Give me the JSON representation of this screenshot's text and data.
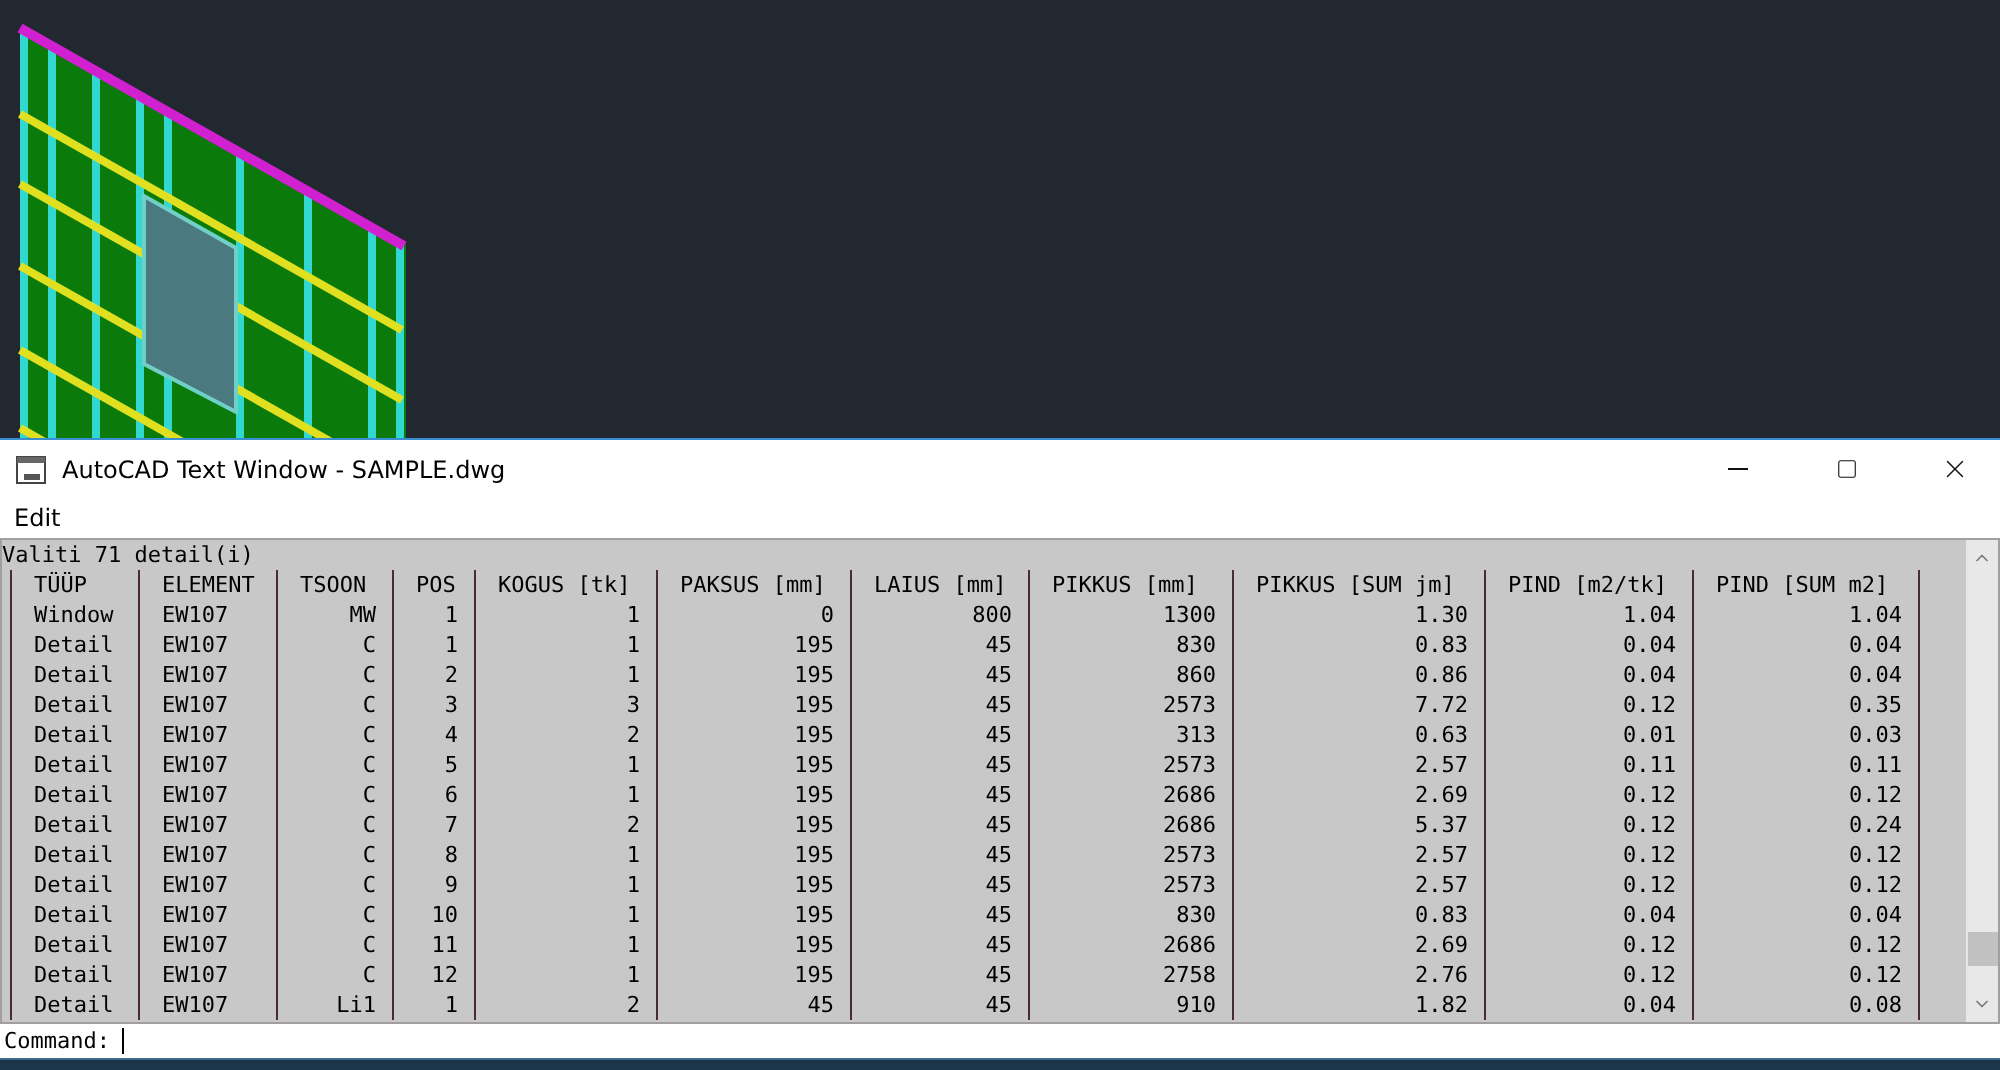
{
  "window": {
    "title": "AutoCAD Text Window - SAMPLE.dwg"
  },
  "menu": [
    "Edit"
  ],
  "output": {
    "message": "Valiti 71 detail(i)",
    "columns": [
      {
        "label": "TÜÜP",
        "kind": "text"
      },
      {
        "label": "ELEMENT",
        "kind": "text"
      },
      {
        "label": "TSOON",
        "kind": "number"
      },
      {
        "label": "POS",
        "kind": "number"
      },
      {
        "label": "KOGUS [tk]",
        "kind": "number"
      },
      {
        "label": "PAKSUS [mm]",
        "kind": "number"
      },
      {
        "label": "LAIUS [mm]",
        "kind": "number"
      },
      {
        "label": "PIKKUS [mm]",
        "kind": "number"
      },
      {
        "label": "PIKKUS [SUM jm]",
        "kind": "number"
      },
      {
        "label": "PIND [m2/tk]",
        "kind": "number"
      },
      {
        "label": "PIND [SUM m2]",
        "kind": "number"
      }
    ],
    "rows": [
      [
        "Window",
        "EW107",
        "MW",
        "1",
        "1",
        "0",
        "800",
        "1300",
        "1.30",
        "1.04",
        "1.04"
      ],
      [
        "Detail",
        "EW107",
        "C",
        "1",
        "1",
        "195",
        "45",
        "830",
        "0.83",
        "0.04",
        "0.04"
      ],
      [
        "Detail",
        "EW107",
        "C",
        "2",
        "1",
        "195",
        "45",
        "860",
        "0.86",
        "0.04",
        "0.04"
      ],
      [
        "Detail",
        "EW107",
        "C",
        "3",
        "3",
        "195",
        "45",
        "2573",
        "7.72",
        "0.12",
        "0.35"
      ],
      [
        "Detail",
        "EW107",
        "C",
        "4",
        "2",
        "195",
        "45",
        "313",
        "0.63",
        "0.01",
        "0.03"
      ],
      [
        "Detail",
        "EW107",
        "C",
        "5",
        "1",
        "195",
        "45",
        "2573",
        "2.57",
        "0.11",
        "0.11"
      ],
      [
        "Detail",
        "EW107",
        "C",
        "6",
        "1",
        "195",
        "45",
        "2686",
        "2.69",
        "0.12",
        "0.12"
      ],
      [
        "Detail",
        "EW107",
        "C",
        "7",
        "2",
        "195",
        "45",
        "2686",
        "5.37",
        "0.12",
        "0.24"
      ],
      [
        "Detail",
        "EW107",
        "C",
        "8",
        "1",
        "195",
        "45",
        "2573",
        "2.57",
        "0.12",
        "0.12"
      ],
      [
        "Detail",
        "EW107",
        "C",
        "9",
        "1",
        "195",
        "45",
        "2573",
        "2.57",
        "0.12",
        "0.12"
      ],
      [
        "Detail",
        "EW107",
        "C",
        "10",
        "1",
        "195",
        "45",
        "830",
        "0.83",
        "0.04",
        "0.04"
      ],
      [
        "Detail",
        "EW107",
        "C",
        "11",
        "1",
        "195",
        "45",
        "2686",
        "2.69",
        "0.12",
        "0.12"
      ],
      [
        "Detail",
        "EW107",
        "C",
        "12",
        "1",
        "195",
        "45",
        "2758",
        "2.76",
        "0.12",
        "0.12"
      ],
      [
        "Detail",
        "EW107",
        "Li1",
        "1",
        "2",
        "45",
        "45",
        "910",
        "1.82",
        "0.04",
        "0.08"
      ]
    ]
  },
  "command": {
    "prompt": "Command:"
  }
}
